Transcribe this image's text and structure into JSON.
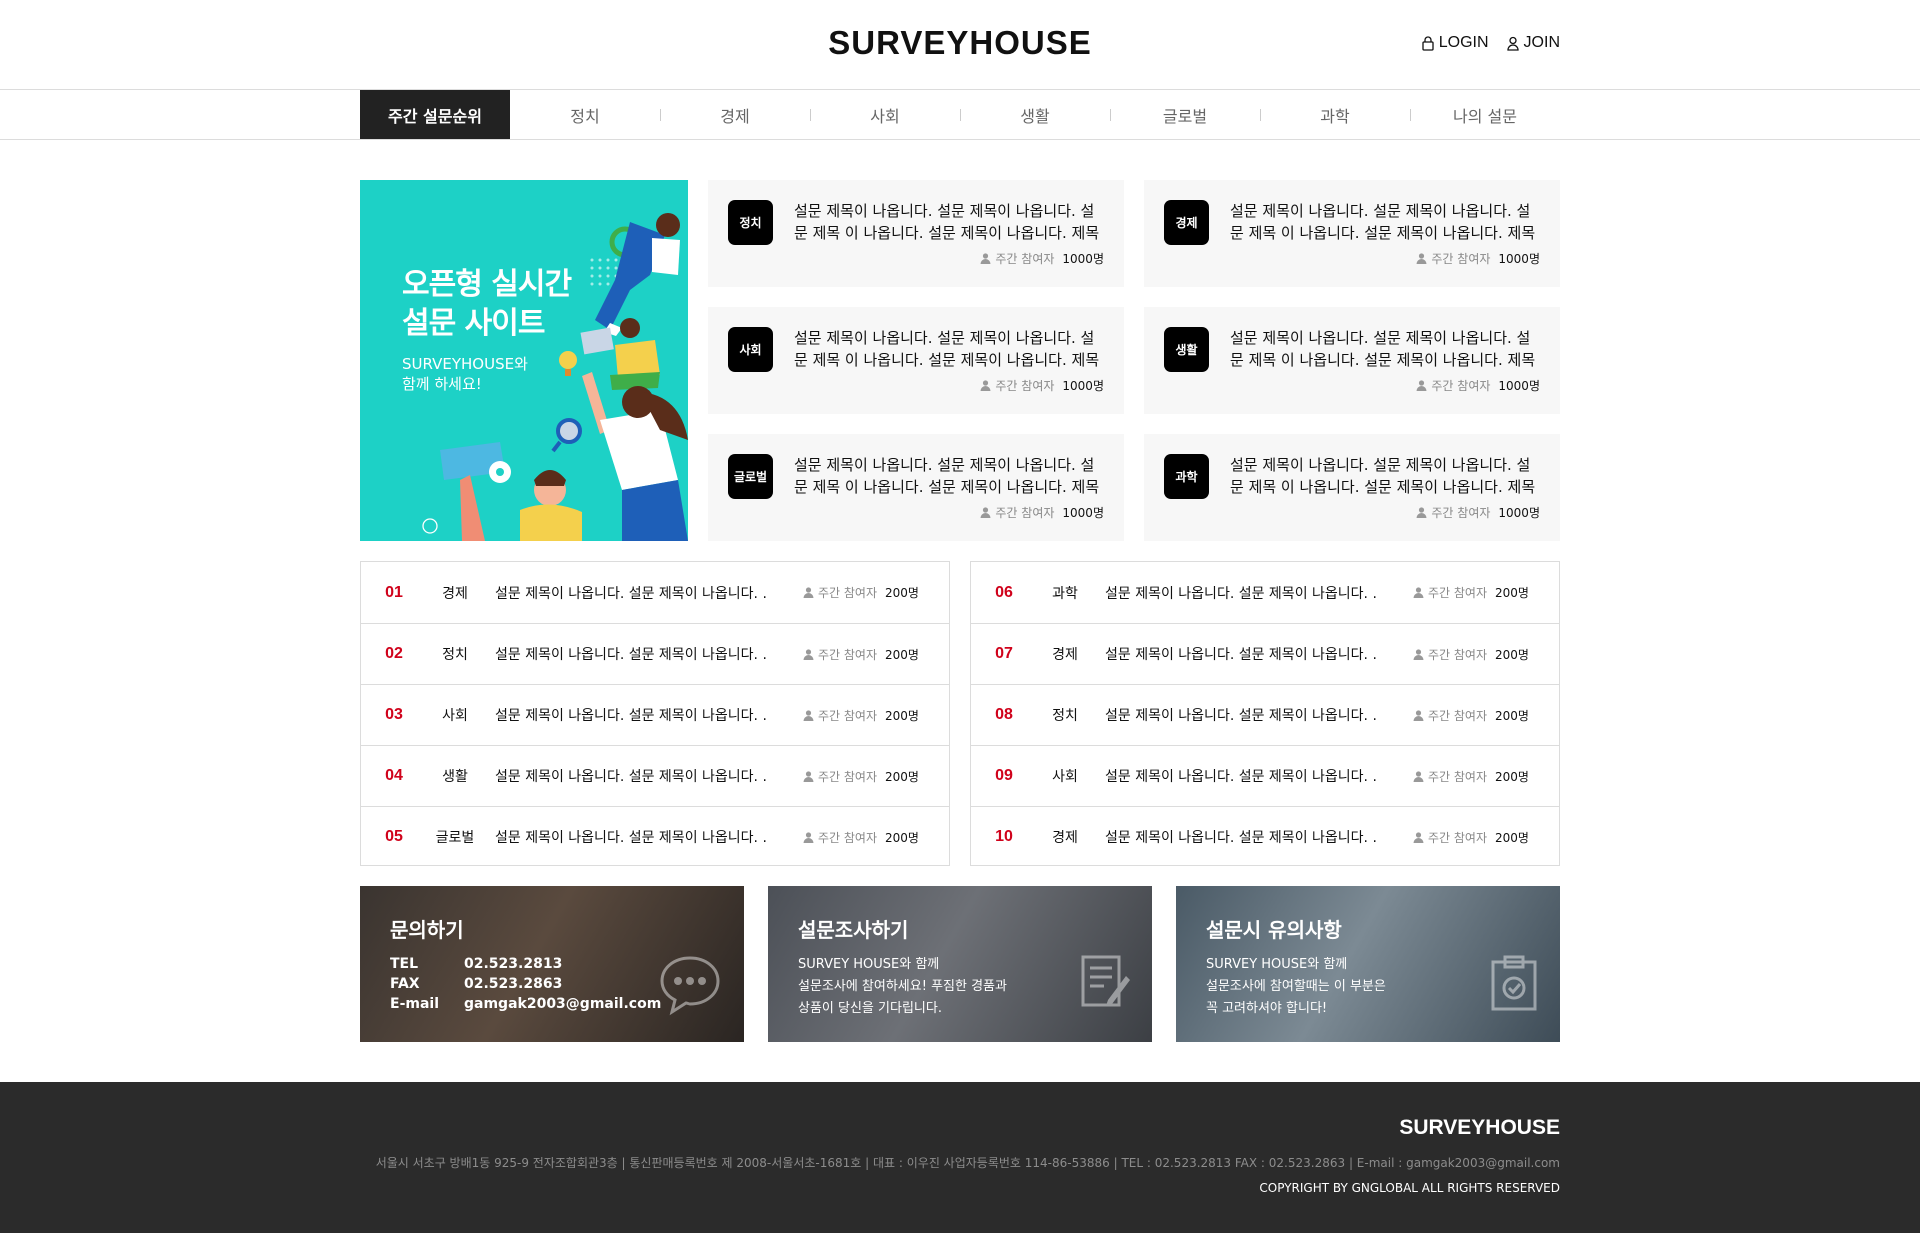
{
  "header": {
    "logo": "SURVEYHOUSE",
    "login": "LOGIN",
    "join": "JOIN"
  },
  "nav": {
    "items": [
      "주간 설문순위",
      "정치",
      "경제",
      "사회",
      "생활",
      "글로벌",
      "과학",
      "나의 설문"
    ],
    "active_index": 0
  },
  "banner": {
    "title_line1": "오픈형 실시간",
    "title_line2": "설문 사이트",
    "sub_line1": "SURVEYHOUSE와",
    "sub_line2": "함께 하세요!"
  },
  "cards": [
    {
      "category": "정치",
      "title": "설문 제목이 나옵니다. 설문 제목이 나옵니다. 설문 제목 이 나옵니다. 설문 제목이 나옵니다. 제목이..",
      "meta_label": "주간 참여자",
      "count": "1000명"
    },
    {
      "category": "경제",
      "title": "설문 제목이 나옵니다. 설문 제목이 나옵니다. 설문 제목 이 나옵니다. 설문 제목이 나옵니다. 제목이..",
      "meta_label": "주간 참여자",
      "count": "1000명"
    },
    {
      "category": "사회",
      "title": "설문 제목이 나옵니다. 설문 제목이 나옵니다. 설문 제목 이 나옵니다. 설문 제목이 나옵니다. 제목이..",
      "meta_label": "주간 참여자",
      "count": "1000명"
    },
    {
      "category": "생활",
      "title": "설문 제목이 나옵니다. 설문 제목이 나옵니다. 설문 제목 이 나옵니다. 설문 제목이 나옵니다. 제목이..",
      "meta_label": "주간 참여자",
      "count": "1000명"
    },
    {
      "category": "글로벌",
      "title": "설문 제목이 나옵니다. 설문 제목이 나옵니다. 설문 제목 이 나옵니다. 설문 제목이 나옵니다. 제목이..",
      "meta_label": "주간 참여자",
      "count": "1000명"
    },
    {
      "category": "과학",
      "title": "설문 제목이 나옵니다. 설문 제목이 나옵니다. 설문 제목 이 나옵니다. 설문 제목이 나옵니다. 제목이..",
      "meta_label": "주간 참여자",
      "count": "1000명"
    }
  ],
  "ranking": [
    {
      "rank": "01",
      "category": "경제",
      "title": "설문 제목이 나옵니다. 설문 제목이 나옵니다. .",
      "meta_label": "주간 참여자",
      "count": "200명"
    },
    {
      "rank": "02",
      "category": "정치",
      "title": "설문 제목이 나옵니다. 설문 제목이 나옵니다. .",
      "meta_label": "주간 참여자",
      "count": "200명"
    },
    {
      "rank": "03",
      "category": "사회",
      "title": "설문 제목이 나옵니다. 설문 제목이 나옵니다. .",
      "meta_label": "주간 참여자",
      "count": "200명"
    },
    {
      "rank": "04",
      "category": "생활",
      "title": "설문 제목이 나옵니다. 설문 제목이 나옵니다. .",
      "meta_label": "주간 참여자",
      "count": "200명"
    },
    {
      "rank": "05",
      "category": "글로벌",
      "title": "설문 제목이 나옵니다. 설문 제목이 나옵니다. .",
      "meta_label": "주간 참여자",
      "count": "200명"
    },
    {
      "rank": "06",
      "category": "과학",
      "title": "설문 제목이 나옵니다. 설문 제목이 나옵니다. .",
      "meta_label": "주간 참여자",
      "count": "200명"
    },
    {
      "rank": "07",
      "category": "경제",
      "title": "설문 제목이 나옵니다. 설문 제목이 나옵니다. .",
      "meta_label": "주간 참여자",
      "count": "200명"
    },
    {
      "rank": "08",
      "category": "정치",
      "title": "설문 제목이 나옵니다. 설문 제목이 나옵니다. .",
      "meta_label": "주간 참여자",
      "count": "200명"
    },
    {
      "rank": "09",
      "category": "사회",
      "title": "설문 제목이 나옵니다. 설문 제목이 나옵니다. .",
      "meta_label": "주간 참여자",
      "count": "200명"
    },
    {
      "rank": "10",
      "category": "경제",
      "title": "설문 제목이 나옵니다. 설문 제목이 나옵니다. .",
      "meta_label": "주간 참여자",
      "count": "200명"
    }
  ],
  "info": {
    "contact": {
      "title": "문의하기",
      "tel_label": "TEL",
      "tel": "02.523.2813",
      "fax_label": "FAX",
      "fax": "02.523.2863",
      "email_label": "E-mail",
      "email": "gamgak2003@gmail.com"
    },
    "survey": {
      "title": "설문조사하기",
      "line1": "SURVEY HOUSE와 함께",
      "line2": "설문조사에 참여하세요! 푸짐한 경품과",
      "line3": "상품이 당신을 기다립니다."
    },
    "notice": {
      "title": "설문시 유의사항",
      "line1": "SURVEY HOUSE와 함께",
      "line2": "설문조사에 참여할때는 이 부분은",
      "line3": "꼭 고려하셔야 합니다!"
    }
  },
  "footer": {
    "logo": "SURVEYHOUSE",
    "address": "서울시 서초구 방배1동 925-9 전자조합회관3층  |  통신판매등록번호 제 2008-서울서초-1681호  |  대표 : 이우진    사업자등록번호 114-86-53886  |  TEL : 02.523.2813    FAX : 02.523.2863  |  E-mail : gamgak2003@gmail.com",
    "copyright": "COPYRIGHT BY GNGLOBAL ALL RIGHTS RESERVED"
  },
  "colors": {
    "accent_teal": "#1dd1c6",
    "rank_red": "#d0021b",
    "nav_active": "#222222",
    "footer_bg": "#2b2b2b"
  },
  "icons": {
    "login": "lock-icon",
    "join": "user-icon",
    "participants": "person-icon"
  }
}
